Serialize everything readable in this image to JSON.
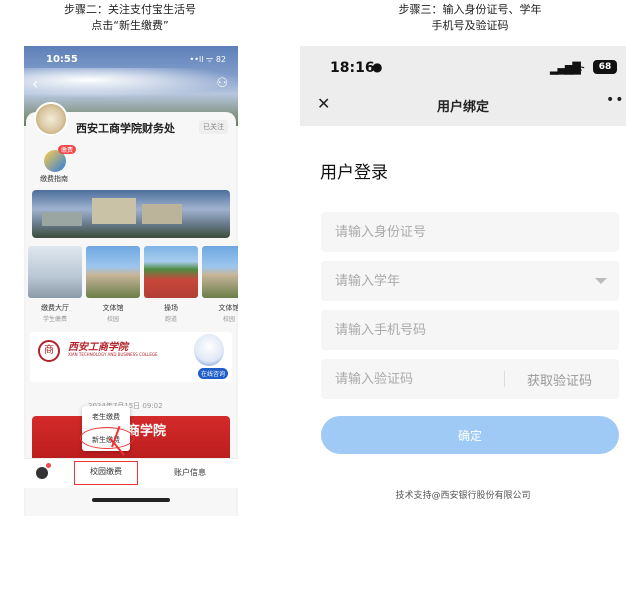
{
  "steps": {
    "step2_line1": "步骤二：关注支付宝生活号",
    "step2_line2": "点击“新生缴费”",
    "step3_line1": "步骤三：输入身份证号、学年",
    "step3_line2": "手机号及验证码"
  },
  "left_phone": {
    "time": "10:55",
    "status_icons": "••ll ᯤ 82",
    "org_name": "西安工商学院财务处",
    "follow_label": "已关注",
    "guide_badge": "缴费",
    "guide_label": "缴费指南",
    "tiles": [
      {
        "title": "缴费大厅",
        "sub": "学生缴费"
      },
      {
        "title": "文体馆",
        "sub": "校园"
      },
      {
        "title": "操场",
        "sub": "跑道"
      },
      {
        "title": "文体馆",
        "sub": "校园"
      }
    ],
    "school_cn": "西安工商学院",
    "school_en": "XIAN TECHNOLOGY AND BUSINESS COLLEGE",
    "seal_char": "商",
    "online_consult": "在线咨询",
    "date": "2024年7月15日 09:02",
    "red_banner_text": "工商学院",
    "popup_items": [
      "老生缴费",
      "新生缴费"
    ],
    "tabbar": {
      "campus_pay": "校园缴费",
      "account_info": "账户信息"
    }
  },
  "right_phone": {
    "time": "18:16",
    "signal": "▂▄▆█",
    "wifi": "ᯤ",
    "battery": "68",
    "page_title": "用户绑定",
    "more": "•••",
    "close": "✕",
    "heading": "用户登录",
    "fields": {
      "id_placeholder": "请输入身份证号",
      "year_placeholder": "请输入学年",
      "phone_placeholder": "请输入手机号码",
      "code_placeholder": "请输入验证码"
    },
    "get_code": "获取验证码",
    "confirm": "确定",
    "footer": "技术支持@西安银行股份有限公司"
  }
}
